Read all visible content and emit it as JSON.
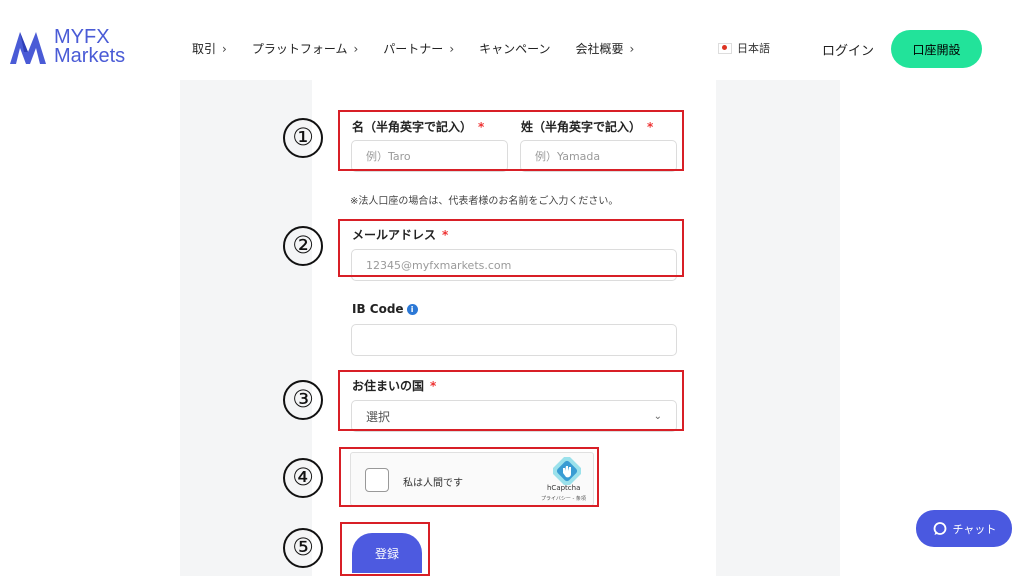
{
  "brand": {
    "line1": "MYFX",
    "line2": "Markets",
    "color": "#4a5bd6"
  },
  "nav": [
    {
      "label": "取引",
      "chevron": "›"
    },
    {
      "label": "プラットフォーム",
      "chevron": "›"
    },
    {
      "label": "パートナー",
      "chevron": "›"
    },
    {
      "label": "キャンペーン",
      "chevron": ""
    },
    {
      "label": "会社概要",
      "chevron": "›"
    }
  ],
  "header": {
    "language": "日本語",
    "login": "ログイン",
    "open_account": "口座開設",
    "open_account_color": "#22e39a"
  },
  "form": {
    "first_name": {
      "label": "名（半角英字で記入）",
      "required": "*",
      "placeholder": "例）Taro"
    },
    "last_name": {
      "label": "姓（半角英字で記入）",
      "required": "*",
      "placeholder": "例）Yamada"
    },
    "corporate_note": "※法人口座の場合は、代表者様のお名前をご入力ください。",
    "email": {
      "label": "メールアドレス",
      "required": "*",
      "placeholder": "12345@myfxmarkets.com"
    },
    "ib_code": {
      "label": "IB Code",
      "info": "i",
      "value": ""
    },
    "country": {
      "label": "お住まいの国",
      "required": "*",
      "selected": "選択"
    },
    "captcha": {
      "text": "私は人間です",
      "brand": "hCaptcha",
      "links": "プライバシー - 条項"
    },
    "submit": "登録"
  },
  "annotations": {
    "n1": "①",
    "n2": "②",
    "n3": "③",
    "n4": "④",
    "n5": "⑤",
    "color": "#d81f26"
  },
  "chat": {
    "label": "チャット",
    "color": "#4a59e0"
  }
}
